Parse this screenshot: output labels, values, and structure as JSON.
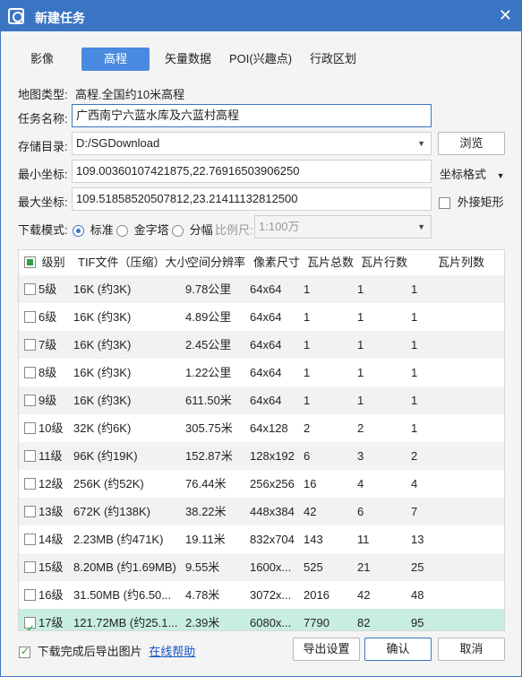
{
  "window": {
    "title": "新建任务",
    "close_glyph": "✕"
  },
  "tabs": [
    {
      "label": "影像"
    },
    {
      "label": "高程",
      "active": true
    },
    {
      "label": "矢量数据"
    },
    {
      "label": "POI(兴趣点)"
    },
    {
      "label": "行政区划"
    }
  ],
  "map_type": {
    "label": "地图类型:",
    "value": "高程.全国约10米高程"
  },
  "task_name": {
    "label": "任务名称:",
    "value": "广西南宁六蓝水库及六蓝村高程"
  },
  "storage": {
    "label": "存储目录:",
    "value": "D:/SGDownload",
    "browse_label": "浏览"
  },
  "min_coord": {
    "label": "最小坐标:",
    "value": "109.00360107421875,22.76916503906250",
    "format_label": "坐标格式"
  },
  "max_coord": {
    "label": "最大坐标:",
    "value": "109.51858520507812,23.21411132812500",
    "bounding_label": "外接矩形"
  },
  "download_mode": {
    "label": "下载模式:",
    "options": [
      "标准",
      "金字塔",
      "分幅"
    ],
    "selected": "标准",
    "scale_label": "比例尺:",
    "scale_value": "1:100万"
  },
  "table": {
    "headers": [
      "级别",
      "TIF文件（压缩）大小",
      "空间分辨率",
      "像素尺寸",
      "瓦片总数",
      "瓦片行数",
      "瓦片列数"
    ],
    "rows": [
      {
        "level": "5级",
        "size": "16K (约3K)",
        "res": "9.78公里",
        "pixels": "64x64",
        "total": "1",
        "rows": "1",
        "cols": "1",
        "checked": false
      },
      {
        "level": "6级",
        "size": "16K (约3K)",
        "res": "4.89公里",
        "pixels": "64x64",
        "total": "1",
        "rows": "1",
        "cols": "1",
        "checked": false
      },
      {
        "level": "7级",
        "size": "16K (约3K)",
        "res": "2.45公里",
        "pixels": "64x64",
        "total": "1",
        "rows": "1",
        "cols": "1",
        "checked": false
      },
      {
        "level": "8级",
        "size": "16K (约3K)",
        "res": "1.22公里",
        "pixels": "64x64",
        "total": "1",
        "rows": "1",
        "cols": "1",
        "checked": false
      },
      {
        "level": "9级",
        "size": "16K (约3K)",
        "res": "611.50米",
        "pixels": "64x64",
        "total": "1",
        "rows": "1",
        "cols": "1",
        "checked": false
      },
      {
        "level": "10级",
        "size": "32K (约6K)",
        "res": "305.75米",
        "pixels": "64x128",
        "total": "2",
        "rows": "2",
        "cols": "1",
        "checked": false
      },
      {
        "level": "11级",
        "size": "96K (约19K)",
        "res": "152.87米",
        "pixels": "128x192",
        "total": "6",
        "rows": "3",
        "cols": "2",
        "checked": false
      },
      {
        "level": "12级",
        "size": "256K (约52K)",
        "res": "76.44米",
        "pixels": "256x256",
        "total": "16",
        "rows": "4",
        "cols": "4",
        "checked": false
      },
      {
        "level": "13级",
        "size": "672K (约138K)",
        "res": "38.22米",
        "pixels": "448x384",
        "total": "42",
        "rows": "6",
        "cols": "7",
        "checked": false
      },
      {
        "level": "14级",
        "size": "2.23MB (约471K)",
        "res": "19.11米",
        "pixels": "832x704",
        "total": "143",
        "rows": "11",
        "cols": "13",
        "checked": false
      },
      {
        "level": "15级",
        "size": "8.20MB (约1.69MB)",
        "res": "9.55米",
        "pixels": "1600x...",
        "total": "525",
        "rows": "21",
        "cols": "25",
        "checked": false
      },
      {
        "level": "16级",
        "size": "31.50MB (约6.50...",
        "res": "4.78米",
        "pixels": "3072x...",
        "total": "2016",
        "rows": "42",
        "cols": "48",
        "checked": false
      },
      {
        "level": "17级",
        "size": "121.72MB (约25.1...",
        "res": "2.39米",
        "pixels": "6080x...",
        "total": "7790",
        "rows": "82",
        "cols": "95",
        "checked": true
      }
    ]
  },
  "footer": {
    "export_label": "下载完成后导出图片",
    "help_link": "在线帮助",
    "export_settings": "导出设置",
    "confirm": "确认",
    "cancel": "取消"
  },
  "colors": {
    "titlebar": "#3a75c4",
    "active_tab": "#4a8ae0",
    "selected_row": "#c8eee0"
  }
}
